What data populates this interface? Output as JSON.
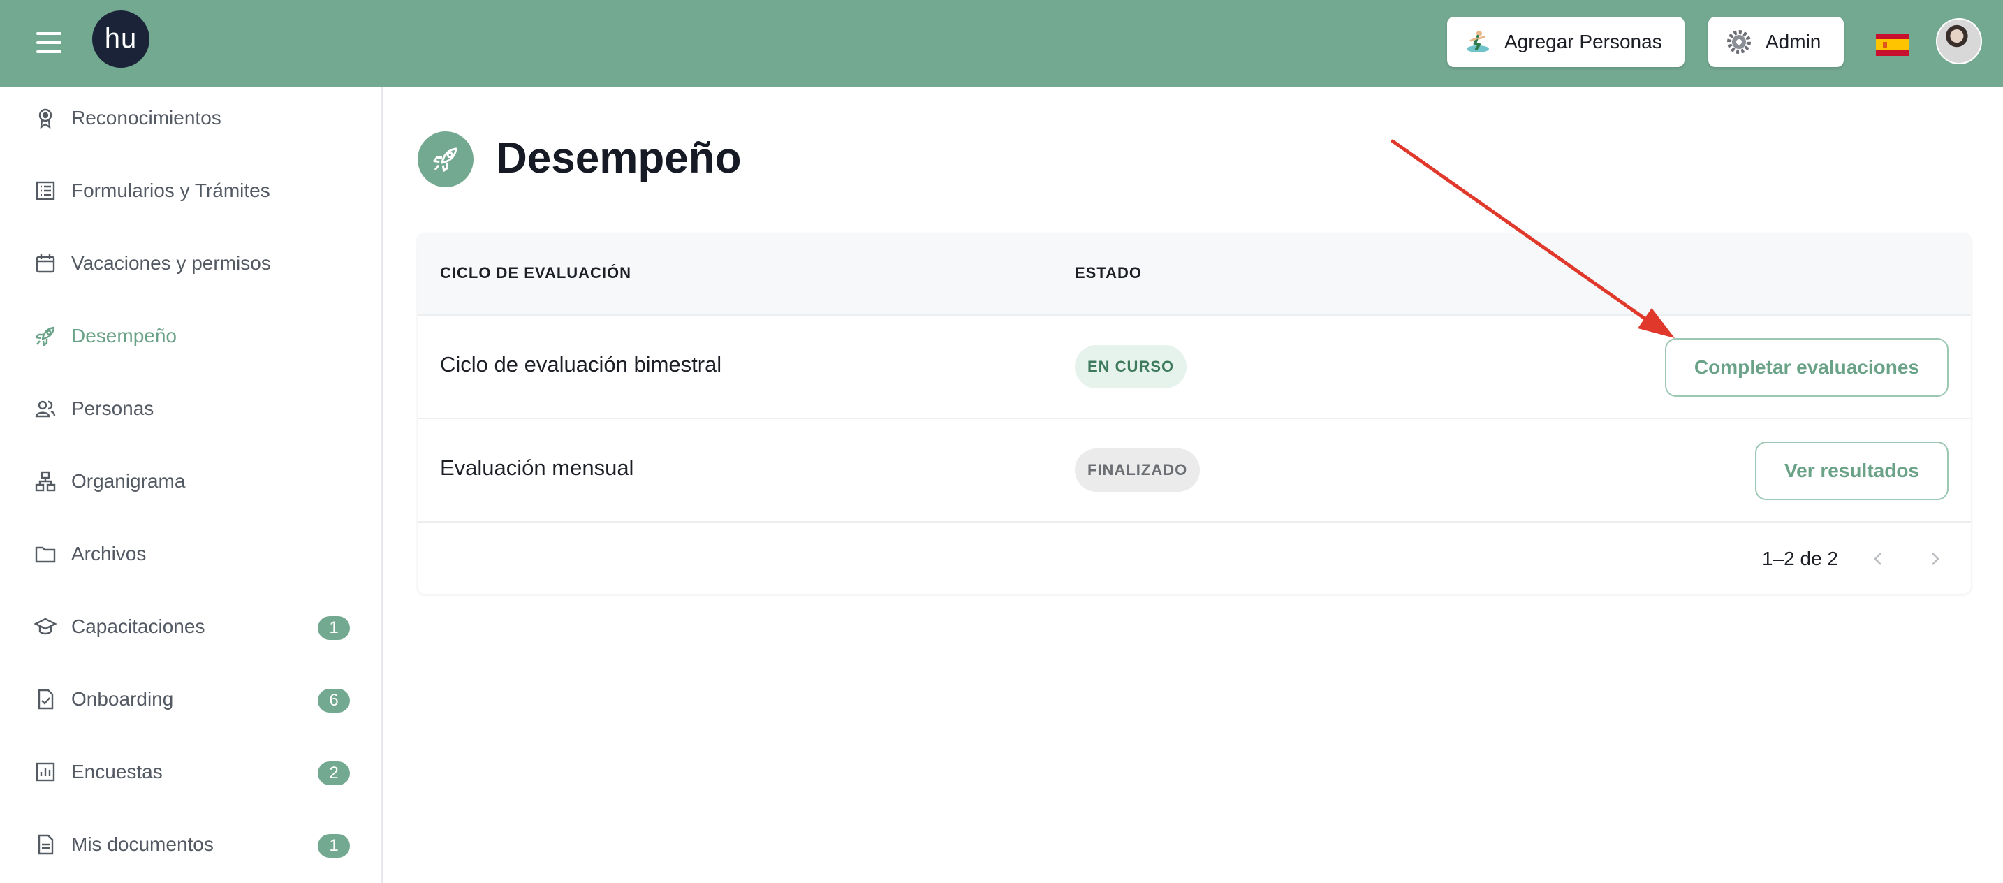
{
  "header": {
    "logo_text": "hu",
    "add_people_label": "Agregar Personas",
    "admin_label": "Admin"
  },
  "sidebar": {
    "items": [
      {
        "label": "Reconocimientos",
        "icon": "award-icon"
      },
      {
        "label": "Formularios y Trámites",
        "icon": "list-icon"
      },
      {
        "label": "Vacaciones y permisos",
        "icon": "calendar-icon"
      },
      {
        "label": "Desempeño",
        "icon": "rocket-icon",
        "active": true
      },
      {
        "label": "Personas",
        "icon": "people-icon"
      },
      {
        "label": "Organigrama",
        "icon": "org-chart-icon"
      },
      {
        "label": "Archivos",
        "icon": "folder-icon"
      },
      {
        "label": "Capacitaciones",
        "icon": "graduation-cap-icon",
        "badge": "1"
      },
      {
        "label": "Onboarding",
        "icon": "file-check-icon",
        "badge": "6"
      },
      {
        "label": "Encuestas",
        "icon": "bar-chart-icon",
        "badge": "2"
      },
      {
        "label": "Mis documentos",
        "icon": "document-icon",
        "badge": "1"
      }
    ]
  },
  "main": {
    "title": "Desempeño",
    "table": {
      "headers": [
        "CICLO DE EVALUACIÓN",
        "ESTADO"
      ],
      "rows": [
        {
          "name": "Ciclo de evaluación bimestral",
          "status": "EN CURSO",
          "action": "Completar evaluaciones"
        },
        {
          "name": "Evaluación mensual",
          "status": "FINALIZADO",
          "action": "Ver resultados"
        }
      ],
      "pagination": "1–2 de 2"
    }
  },
  "colors": {
    "brand": "#74a991",
    "brand_text": "#6aa287",
    "annotation_arrow": "#e0392b"
  }
}
